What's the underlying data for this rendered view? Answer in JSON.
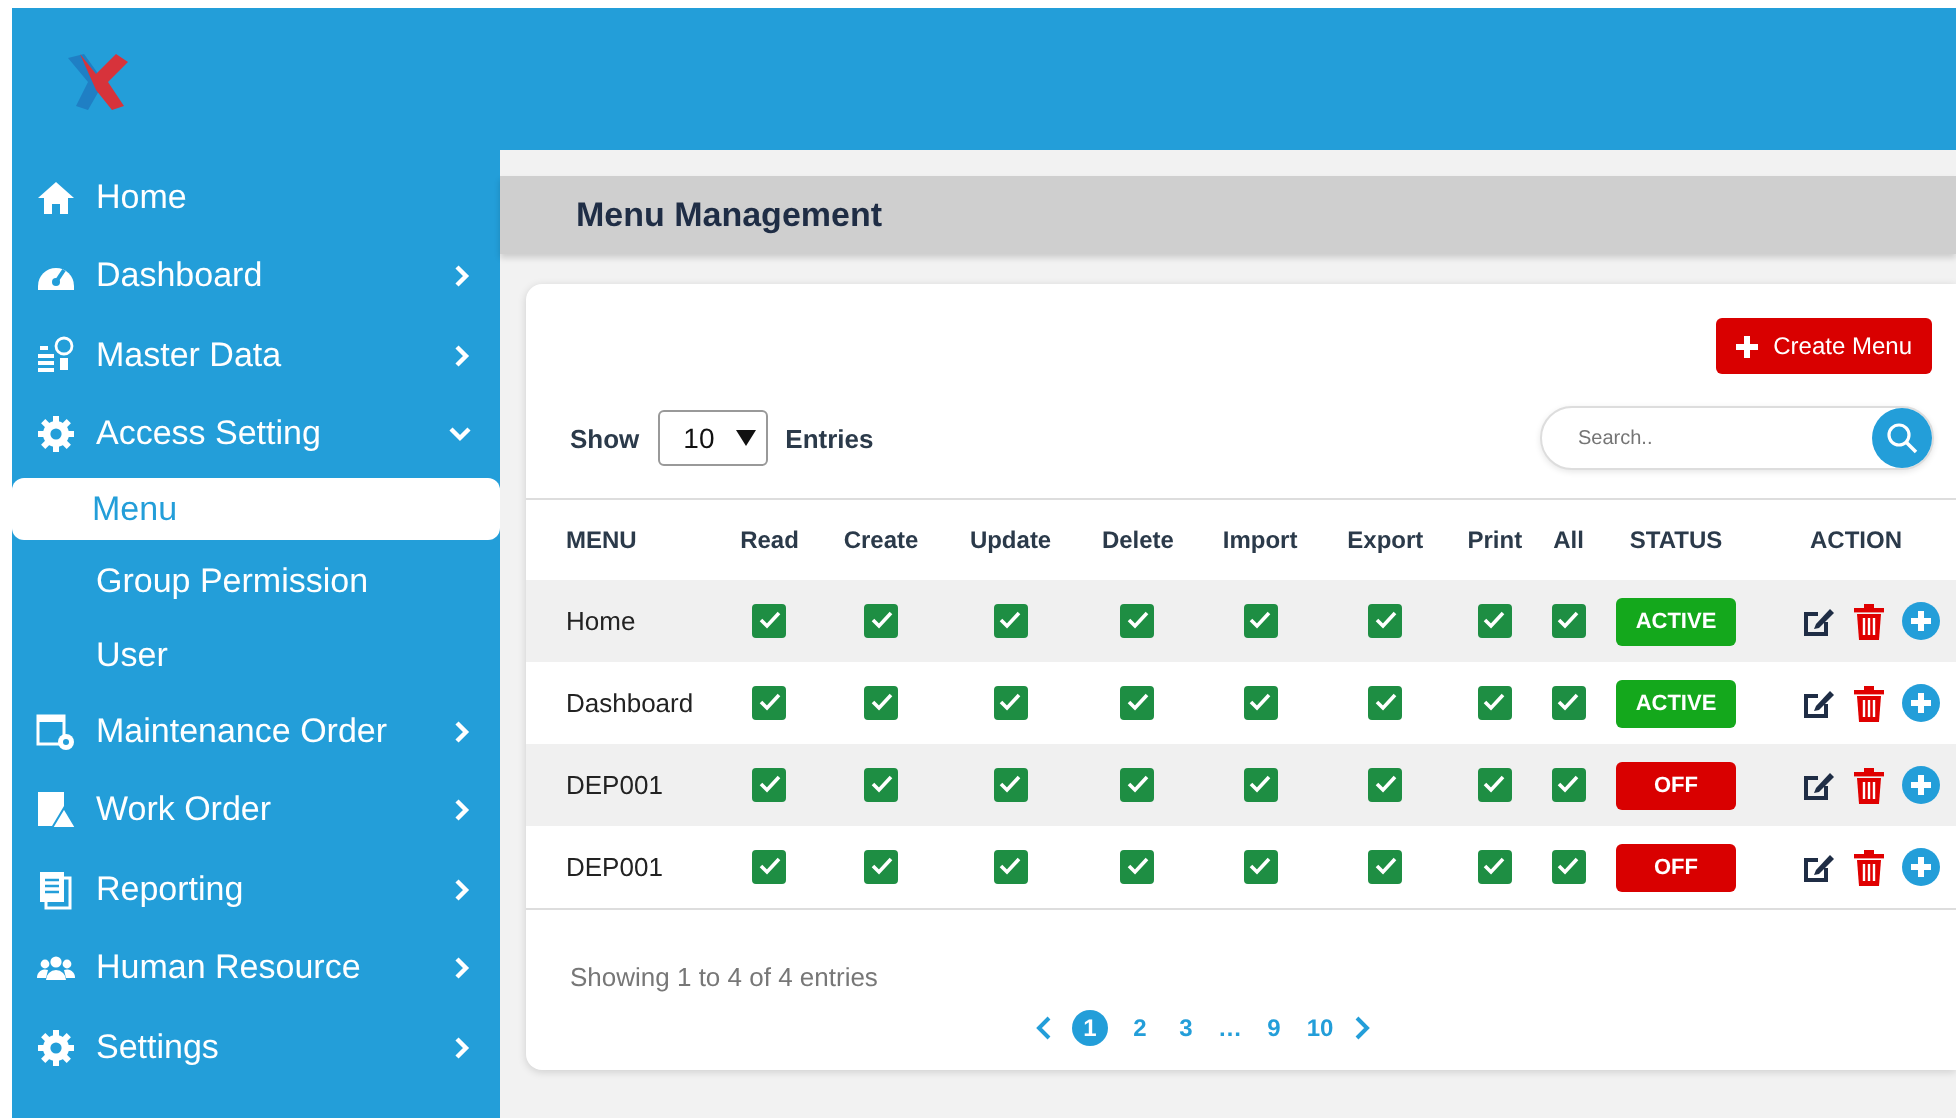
{
  "sidebar": {
    "items": [
      {
        "label": "Home",
        "selected": false
      },
      {
        "label": "Dashboard",
        "expanded": false,
        "selected": false
      },
      {
        "label": "Master Data",
        "expanded": false,
        "selected": false
      },
      {
        "label": "Access Setting",
        "expanded": true,
        "selected": false,
        "children": [
          {
            "label": "Menu",
            "selected": true
          },
          {
            "label": "Group Permission",
            "selected": false
          },
          {
            "label": "User",
            "selected": false
          }
        ]
      },
      {
        "label": "Maintenance Order",
        "expanded": false,
        "selected": false
      },
      {
        "label": "Work Order",
        "expanded": false,
        "selected": false
      },
      {
        "label": "Reporting",
        "expanded": false,
        "selected": false
      },
      {
        "label": "Human Resource",
        "expanded": false,
        "selected": false
      },
      {
        "label": "Settings",
        "expanded": false,
        "selected": false
      }
    ]
  },
  "page_title": "Menu Management",
  "create_button": "Create Menu",
  "show": {
    "label": "Show",
    "value": "10",
    "suffix": "Entries"
  },
  "search": {
    "placeholder": "Search.."
  },
  "table": {
    "columns": [
      "MENU",
      "Read",
      "Create",
      "Update",
      "Delete",
      "Import",
      "Export",
      "Print",
      "All",
      "STATUS",
      "ACTION"
    ],
    "rows": [
      {
        "menu": "Home",
        "permissions": [
          {
            "checked": true
          },
          {
            "checked": true
          },
          {
            "checked": true
          },
          {
            "checked": true
          },
          {
            "checked": true
          },
          {
            "checked": true
          },
          {
            "checked": true
          },
          {
            "checked": true
          }
        ],
        "status": {
          "label": "ACTIVE",
          "active": true
        }
      },
      {
        "menu": "Dashboard",
        "permissions": [
          {
            "checked": true
          },
          {
            "checked": true
          },
          {
            "checked": true
          },
          {
            "checked": true
          },
          {
            "checked": true
          },
          {
            "checked": true
          },
          {
            "checked": true
          },
          {
            "checked": true
          }
        ],
        "status": {
          "label": "ACTIVE",
          "active": true
        }
      },
      {
        "menu": "DEP001",
        "permissions": [
          {
            "checked": true
          },
          {
            "checked": true
          },
          {
            "checked": true
          },
          {
            "checked": true
          },
          {
            "checked": true
          },
          {
            "checked": true
          },
          {
            "checked": true
          },
          {
            "checked": true
          }
        ],
        "status": {
          "label": "OFF",
          "active": false
        }
      },
      {
        "menu": "DEP001",
        "permissions": [
          {
            "checked": true
          },
          {
            "checked": true
          },
          {
            "checked": true
          },
          {
            "checked": true
          },
          {
            "checked": true
          },
          {
            "checked": true
          },
          {
            "checked": true
          },
          {
            "checked": true
          }
        ],
        "status": {
          "label": "OFF",
          "active": false
        }
      }
    ]
  },
  "footer": "Showing 1 to 4 of 4 entries",
  "pagination": [
    {
      "label": "1",
      "kind": "page",
      "selected": true
    },
    {
      "label": "2",
      "kind": "page",
      "selected": false
    },
    {
      "label": "3",
      "kind": "page",
      "selected": false
    },
    {
      "label": "…",
      "kind": "ellipsis",
      "selected": false
    },
    {
      "label": "9",
      "kind": "page",
      "selected": false
    },
    {
      "label": "10",
      "kind": "page",
      "selected": false
    }
  ]
}
